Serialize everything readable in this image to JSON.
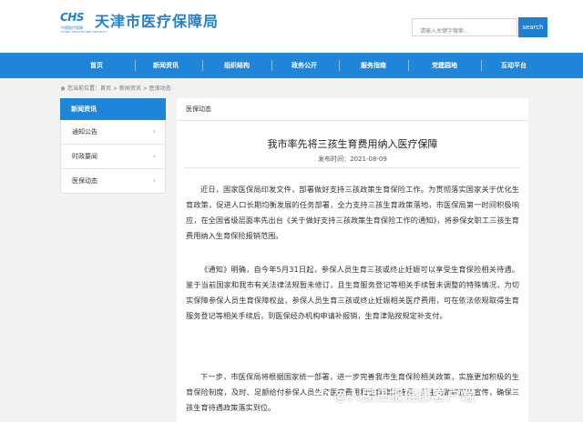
{
  "header": {
    "logo_text": "CHS",
    "logo_sub": "中国医疗保障",
    "logo_sub_en": "CHINA HEALTHCARE SECURITY",
    "site_title": "天津市医疗保障局",
    "search_placeholder": "请输入关键字搜索...",
    "search_button": "search"
  },
  "nav": {
    "items": [
      "首页",
      "新闻资讯",
      "组织结构",
      "政务公开",
      "服务指南",
      "党建园地",
      "互动平台"
    ]
  },
  "breadcrumb": {
    "prefix": "您当前位置：",
    "home": "首页",
    "sep": ">",
    "level1": "新闻资讯",
    "level2": "医保动态"
  },
  "sidebar": {
    "title": "新闻资讯",
    "items": [
      {
        "label": "通知公告"
      },
      {
        "label": "时政要闻"
      },
      {
        "label": "医保动态"
      }
    ]
  },
  "main": {
    "section_title": "医保动态",
    "article": {
      "title": "我市率先将三孩生育费用纳入医疗保障",
      "date_label": "发布时间：",
      "date": "2021-08-09",
      "paragraphs": [
        "近日，国家医保局印发文件，部署做好支持三孩政策生育保险工作。为贯彻落实国家关于优化生育政策，促进人口长期均衡发展的任务部署，全力支持三孩生育政策落地，市医保局第一时间积极响应，在全国省级层面率先出台《关于做好支持三孩政策生育保险工作的通知》，将参保女职工三孩生育费用纳入生育保险报销范围。",
        "《通知》明确，自今年5月31日起，参保人员生育三孩或终止妊娠可以享受生育保险相关待遇。鉴于当前国家和我市有关法律法规暂未修订，且生育服务登记等相关手续暂未调整的特殊情况，为切实保障参保人员生育保障权益，参保人员生育三孩或终止妊娠相关医疗费用，可在依法依规取得生育服务登记等相关手续后，到医保经办机构申请补报销，生育津贴按规定补支付。",
        "下一步，市医保局将根据国家统一部署，进一步完善我市生育保险相关政策，实施更加积极的生育保险制度，及时、足额给付参保人员生育医疗费用和生育津贴待遇，并主动做好正向宣传，确保三孩生育待遇政策落实到位。"
      ]
    }
  },
  "watermark": {
    "text": "@人民日报健康客户端"
  },
  "colors": {
    "brand_blue": "#1e85d8"
  }
}
